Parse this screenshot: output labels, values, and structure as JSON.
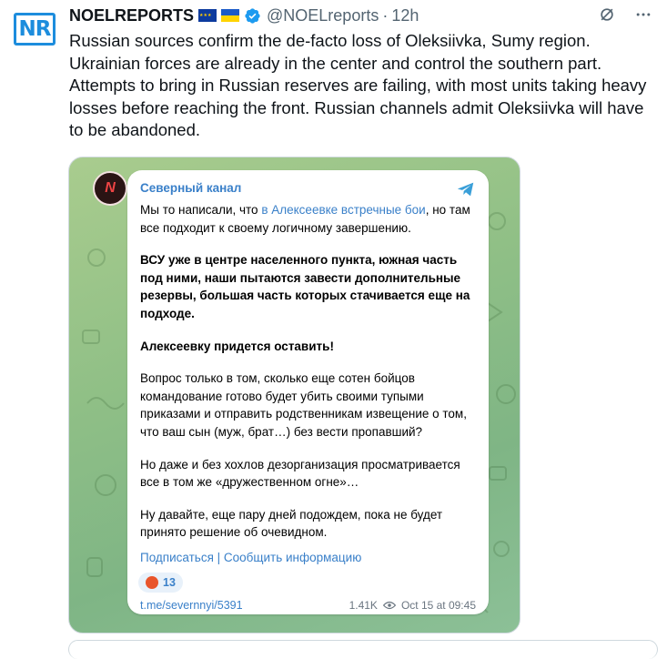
{
  "tweet": {
    "avatar_text": "NR",
    "display_name": "NOELREPORTS",
    "handle": "@NOELreports",
    "separator": "·",
    "time": "12h",
    "text": "Russian sources confirm the de-facto loss of Oleksiivka, Sumy region. Ukrainian forces are already in the center and control the southern part. Attempts to bring in Russian reserves are failing, with most units taking heavy losses before reaching the front. Russian channels admit Oleksiivka will have to be abandoned."
  },
  "telegram": {
    "channel_name": "Северный канал",
    "channel_avatar_text": "N",
    "p1_prefix": "Мы то написали, что ",
    "p1_link": "в Алексеевке встречные бои",
    "p1_suffix": ", но там все подходит к своему логичному завершению.",
    "p2": "ВСУ уже в центре населенного пункта, южная часть под ними, наши пытаются завести дополнительные резервы, большая часть которых стачивается еще на подходе.",
    "p3": "Алексеевку придется оставить!",
    "p4": "Вопрос только в том, сколько еще сотен бойцов командование готово будет убить своими тупыми приказами и отправить родственникам извещение о том, что ваш сын (муж, брат…) без вести пропавший?",
    "p5": "Но даже и без хохлов дезорганизация просматривается все в том же «дружественном огне»…",
    "p6": "Ну давайте, еще пару дней подождем, пока не будет принято решение об очевидном.",
    "subscribe": "Подписаться",
    "divider": " | ",
    "report": "Сообщить информацию",
    "reaction_count": "13",
    "post_link": "t.me/severnnyi/5391",
    "views": "1.41K",
    "date": "Oct 15 at 09:45"
  },
  "colors": {
    "link": "#3a80c9",
    "verified": "#1d9bf0",
    "background_green": "#8fbf86"
  }
}
